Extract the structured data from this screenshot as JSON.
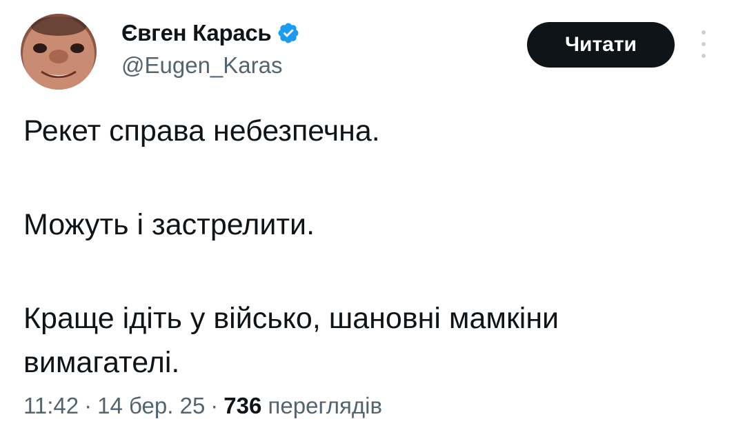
{
  "author": {
    "display_name": "Євген Карась",
    "handle": "@Eugen_Karas",
    "verified_icon": "verified-badge-icon",
    "verified_color": "#1d9bf0"
  },
  "actions": {
    "follow_label": "Читати",
    "more_icon": "more-vertical-icon"
  },
  "tweet": {
    "paragraphs": [
      "Рекет справа небезпечна.",
      "Можуть і застрелити.",
      "Краще ідіть у військо, шановні мамкіни вимагателі."
    ]
  },
  "meta": {
    "time": "11:42",
    "separator": "·",
    "date": "14 бер. 25",
    "views_count": "736",
    "views_label": "переглядів"
  }
}
